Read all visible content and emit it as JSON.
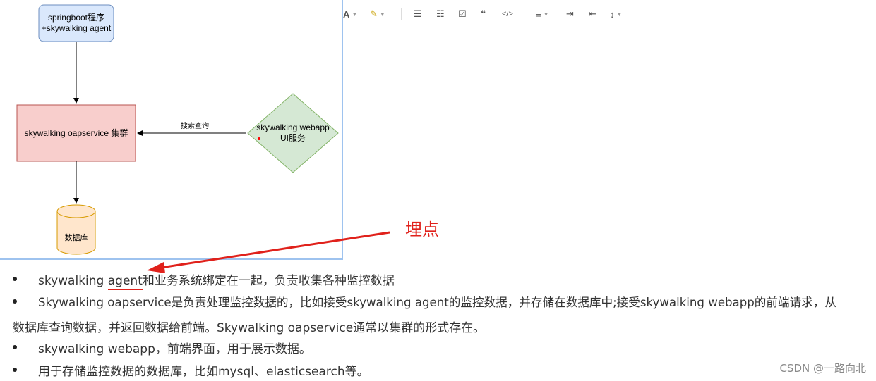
{
  "toolbar": {
    "items": [
      {
        "name": "text-color-icon",
        "glyph": "A"
      },
      {
        "name": "highlight-icon",
        "glyph": "✎"
      },
      {
        "name": "bulleted-list-icon",
        "glyph": "☰"
      },
      {
        "name": "numbered-list-icon",
        "glyph": "☷"
      },
      {
        "name": "checklist-icon",
        "glyph": "☑"
      },
      {
        "name": "blockquote-icon",
        "glyph": "❝"
      },
      {
        "name": "code-block-icon",
        "glyph": "</>"
      },
      {
        "name": "align-icon",
        "glyph": "≡"
      },
      {
        "name": "indent-increase-icon",
        "glyph": "⇥"
      },
      {
        "name": "indent-decrease-icon",
        "glyph": "⇤"
      },
      {
        "name": "line-height-icon",
        "glyph": "↕"
      }
    ]
  },
  "diagram": {
    "app_node": {
      "line1": "springboot程序",
      "line2": "+skywalking agent"
    },
    "oap_node": {
      "label": "skywalking oapservice 集群"
    },
    "webapp_node": {
      "line1": "skywalking webapp",
      "line2": "UI服务"
    },
    "db_node": {
      "label": "数据库"
    },
    "edge_label": "搜索查询",
    "colors": {
      "app_fill": "#dae8fc",
      "app_stroke": "#6c8ebf",
      "oap_fill": "#f8cecc",
      "oap_stroke": "#b85450",
      "webapp_fill": "#d5e8d4",
      "webapp_stroke": "#82b366",
      "db_fill": "#ffe6cc",
      "db_stroke": "#d79b00"
    }
  },
  "annotation": {
    "label": "埋点",
    "color": "#e0211b"
  },
  "bullets": [
    {
      "prefix": "skywalking ",
      "highlight": "agent",
      "rest": "和业务系统绑定在一起，负责收集各种监控数据"
    },
    {
      "line1": "Skywalking oapservice是负责处理监控数据的，比如接受skywalking agent的监控数据，并存储在数据库中;接受skywalking webapp的前端请求，从",
      "line2": "数据库查询数据，并返回数据给前端。Skywalking oapservice通常以集群的形式存在。"
    },
    {
      "text": "skywalking webapp，前端界面，用于展示数据。"
    },
    {
      "text": "用于存储监控数据的数据库，比如mysql、elasticsearch等。"
    }
  ],
  "watermark": "CSDN @一路向北"
}
